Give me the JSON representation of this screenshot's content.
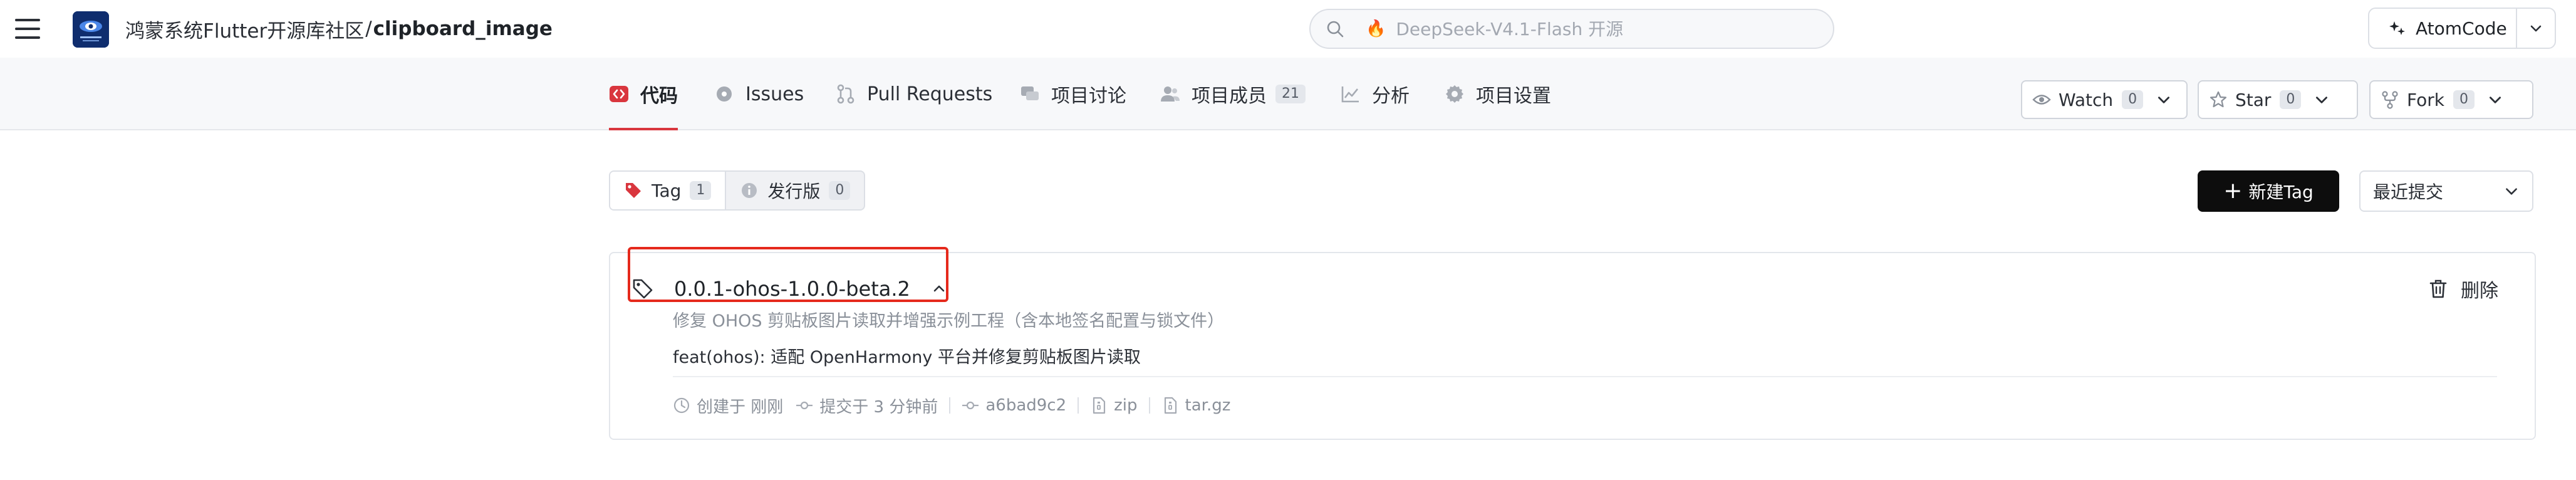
{
  "header": {
    "owner": "鸿蒙系统Flutter开源库社区",
    "separator": "/",
    "repo": "clipboard_image",
    "search_placeholder": "DeepSeek-V4.1-Flash 开源",
    "atomcode_label": "AtomCode"
  },
  "nav": {
    "tabs": [
      {
        "label": "代码",
        "icon": "code-icon",
        "active": true
      },
      {
        "label": "Issues",
        "icon": "issue-icon"
      },
      {
        "label": "Pull Requests",
        "icon": "pull-request-icon"
      },
      {
        "label": "项目讨论",
        "icon": "discussion-icon"
      },
      {
        "label": "项目成员",
        "icon": "members-icon",
        "count": "21"
      },
      {
        "label": "分析",
        "icon": "analysis-icon"
      },
      {
        "label": "项目设置",
        "icon": "settings-icon"
      }
    ],
    "watch": {
      "label": "Watch",
      "count": "0"
    },
    "star": {
      "label": "Star",
      "count": "0"
    },
    "fork": {
      "label": "Fork",
      "count": "0"
    }
  },
  "toolbar": {
    "tag_tab": {
      "label": "Tag",
      "count": "1"
    },
    "release_tab": {
      "label": "发行版",
      "count": "0"
    },
    "new_tag_label": "新建Tag",
    "sort_label": "最近提交"
  },
  "tag": {
    "name": "0.0.1-ohos-1.0.0-beta.2",
    "commit_title": "修复 OHOS 剪贴板图片读取并增强示例工程（含本地签名配置与锁文件）",
    "commit_message": "feat(ohos): 适配 OpenHarmony 平台并修复剪贴板图片读取",
    "created": "创建于 刚刚",
    "committed": "提交于 3 分钟前",
    "sha": "a6bad9c2",
    "zip": "zip",
    "targz": "tar.gz",
    "delete_label": "删除"
  },
  "colors": {
    "accent": "#d9363e",
    "highlight": "#e5291c",
    "primary_button": "#0d0d0d"
  }
}
